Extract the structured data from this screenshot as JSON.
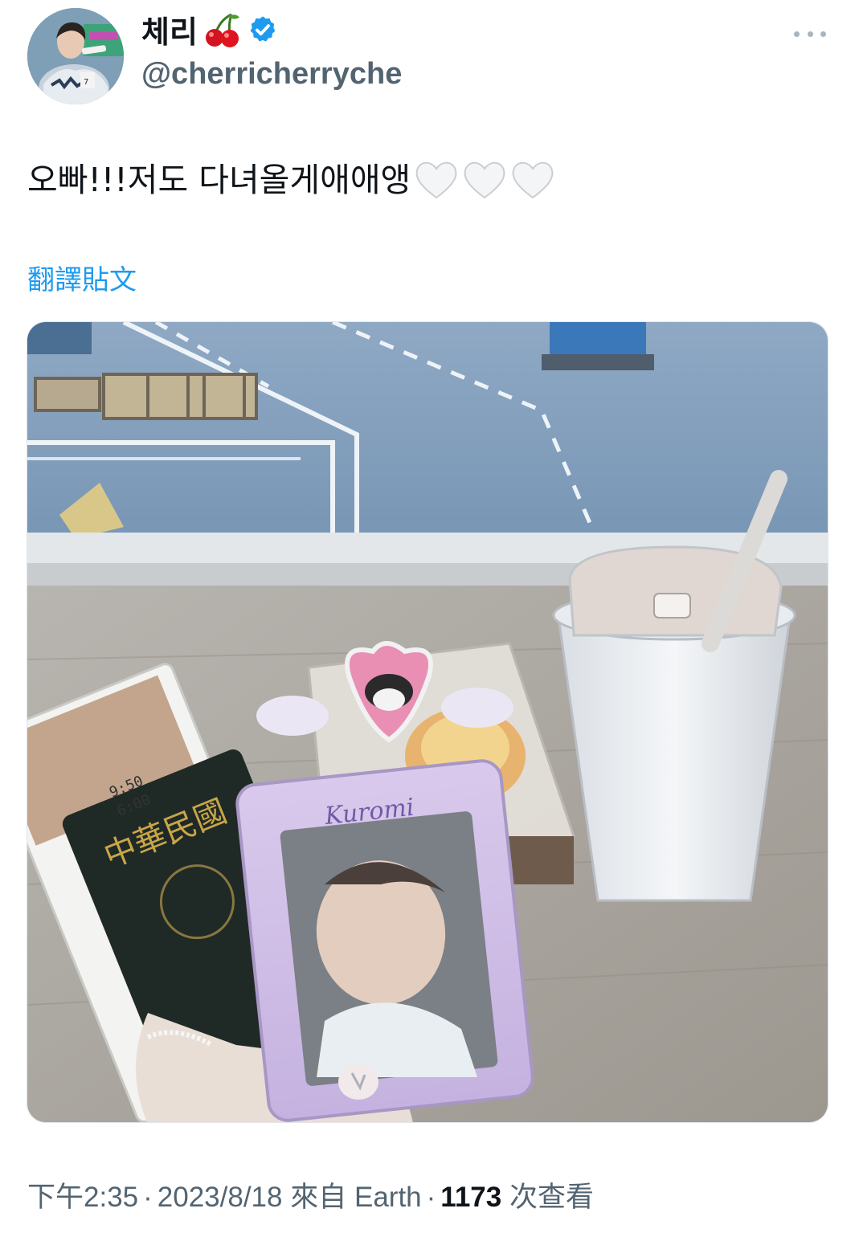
{
  "author": {
    "display_name": "체리",
    "name_emoji_icon": "cherry-icon",
    "verified_icon": "verified-badge-icon",
    "handle": "@cherricherryche",
    "avatar": "avatar-photo"
  },
  "menu": {
    "more_icon": "more-horizontal-icon"
  },
  "tweet": {
    "text": "오빠!!!저도 다녀올게애애앵",
    "trailing_emoji": [
      "white-heart-icon",
      "white-heart-icon",
      "white-heart-icon"
    ],
    "translate_label": "翻譯貼文"
  },
  "media": {
    "kind": "photo",
    "card_brand_text": "Kuromi",
    "passport_text": "中華民國",
    "boarding_times": [
      "9:50",
      "6:00"
    ]
  },
  "meta": {
    "time": "下午2:35",
    "date": "2023/8/18",
    "source_prefix": "來自",
    "source": "Earth",
    "views_count": "1173",
    "views_label": "次查看"
  },
  "colors": {
    "link": "#1d9bf0",
    "secondary_text": "#536471",
    "verified": "#1d9bf0"
  }
}
